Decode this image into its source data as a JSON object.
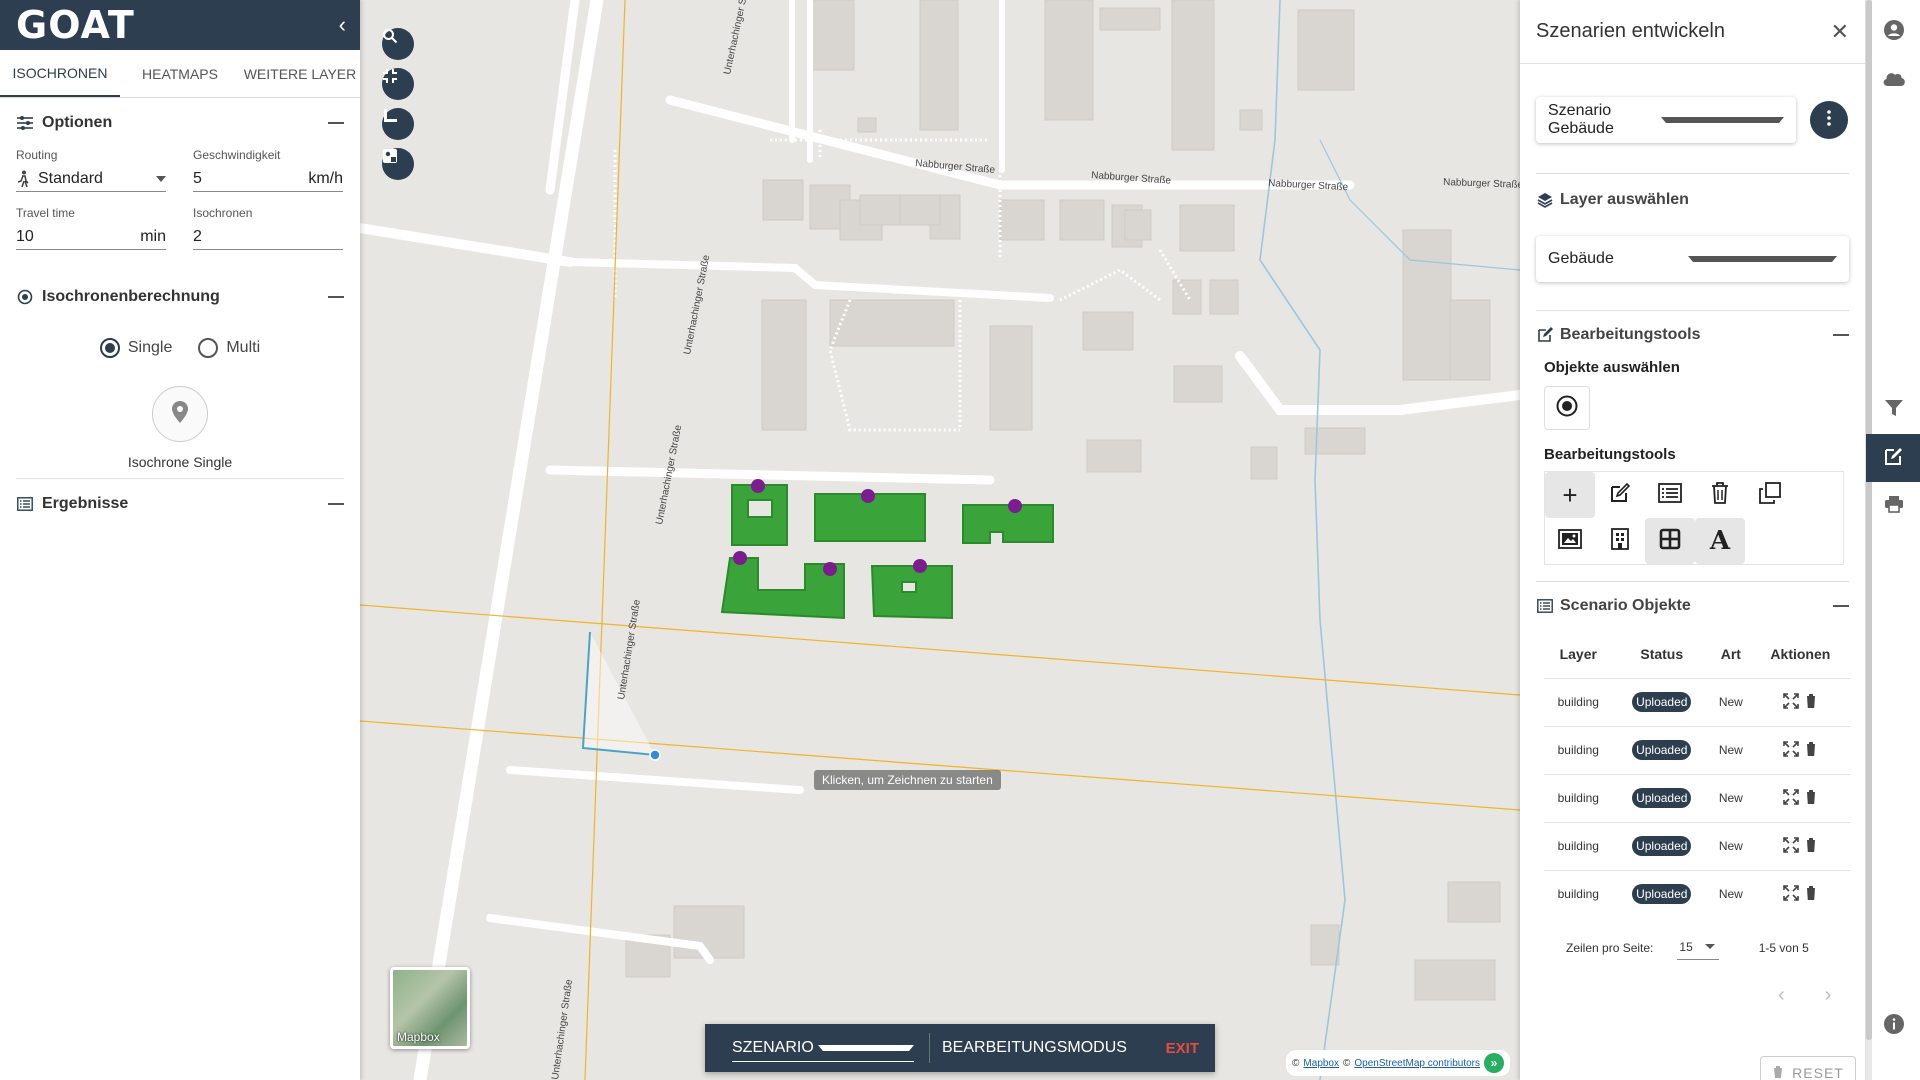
{
  "left_panel": {
    "logo": "GOAT",
    "tabs": [
      "ISOCHRONEN",
      "HEATMAPS",
      "WEITERE LAYER"
    ],
    "options_title": "Optionen",
    "routing_label": "Routing",
    "routing_value": "Standard",
    "speed_label": "Geschwindigkeit",
    "speed_value": "5",
    "speed_unit": "km/h",
    "travel_label": "Travel time",
    "travel_value": "10",
    "travel_unit": "min",
    "iso_label": "Isochronen",
    "iso_value": "2",
    "calc_title": "Isochronenberechnung",
    "radio_single": "Single",
    "radio_multi": "Multi",
    "iso_single_caption": "Isochrone Single",
    "results_title": "Ergebnisse"
  },
  "map": {
    "streets": [
      "Unterhachinger Straße",
      "Unterhachinger Straße",
      "Unterhachinger Straße",
      "Unterhachinger Straße",
      "Unterhachinger Straße",
      "Nabburger Straße",
      "Nabburger Straße",
      "Nabburger Straße",
      "Nabburger Straße"
    ],
    "tooltip": "Klicken, um Zeichnen zu starten",
    "minimap_label": "Mapbox",
    "attribution_prefix": "©",
    "attribution_mapbox": "Mapbox",
    "attribution_osm": "OpenStreetMap contributors",
    "colors": {
      "building_fill": "#3aa33a",
      "vertex": "#7b1c8f",
      "draw_line": "#4aa3c7",
      "grid_line": "#f0b429"
    }
  },
  "scenario_bar": {
    "select_value": "SZENARIO",
    "mode_label": "BEARBEITUNGSMODUS",
    "exit_label": "EXIT"
  },
  "right_panel": {
    "title": "Szenarien entwickeln",
    "scenario_select": "Szenario Gebäude",
    "layer_section": "Layer auswählen",
    "layer_select": "Gebäude",
    "tools_section": "Bearbeitungstools",
    "select_objects_label": "Objekte auswählen",
    "tools_label": "Bearbeitungstools",
    "objects_section": "Scenario Objekte",
    "table_headers": [
      "Layer",
      "Status",
      "Art",
      "Aktionen"
    ],
    "rows": [
      {
        "layer": "building",
        "status": "Uploaded",
        "art": "New"
      },
      {
        "layer": "building",
        "status": "Uploaded",
        "art": "New"
      },
      {
        "layer": "building",
        "status": "Uploaded",
        "art": "New"
      },
      {
        "layer": "building",
        "status": "Uploaded",
        "art": "New"
      },
      {
        "layer": "building",
        "status": "Uploaded",
        "art": "New"
      }
    ],
    "rows_per_page_label": "Zeilen pro Seite:",
    "rows_per_page_value": "15",
    "page_range": "1-5 von 5",
    "reset_label": "RESET"
  }
}
